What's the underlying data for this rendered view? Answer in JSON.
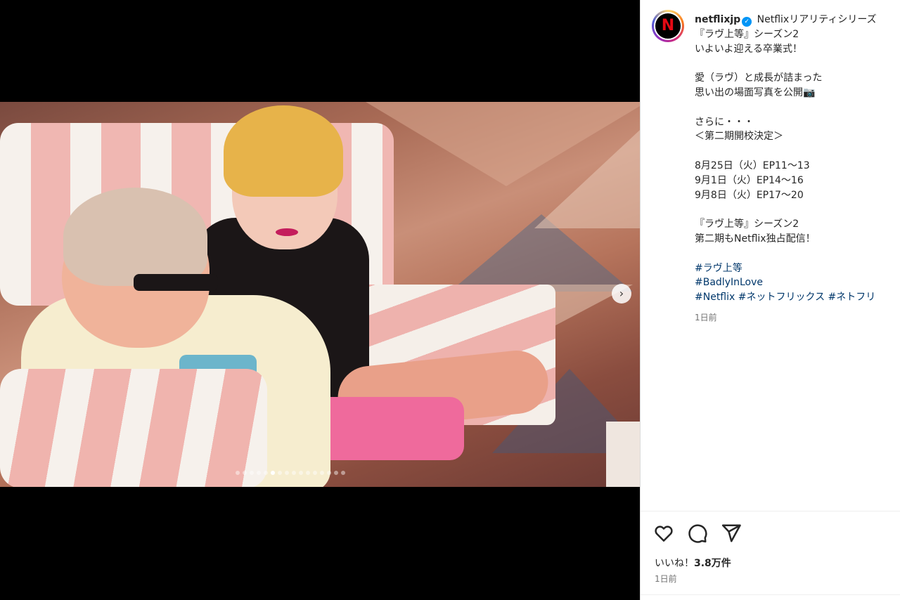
{
  "post": {
    "username": "netflixjp",
    "avatar_letter": "N",
    "verified_glyph": "✓",
    "caption_first": "Netflixリアリティシリーズ",
    "caption_lines": [
      "『ラヴ上等』シーズン2",
      "いよいよ迎える卒業式！",
      "",
      "愛（ラヴ）と成長が詰まった",
      "思い出の場面写真を公開📷",
      "",
      "さらに・・・",
      "＜第二期開校決定＞",
      "",
      "8月25日（火）EP11〜13",
      "9月1日（火）EP14〜16",
      "9月8日（火）EP17〜20",
      "",
      "『ラヴ上等』シーズン2",
      "第二期もNetflix独占配信！",
      ""
    ],
    "hashtags": [
      "#ラヴ上等",
      "#BadlyInLove",
      "#Netflix",
      "#ネットフリックス",
      "#ネトフリ"
    ],
    "caption_time": "1日前",
    "likes_prefix": "いいね！",
    "likes_count": "3.8万件",
    "post_time": "1日前"
  },
  "media": {
    "next_arrow": "›",
    "carousel_total": 16,
    "carousel_active_index": 5
  },
  "colors": {
    "link": "#00376b",
    "verified": "#0095f6",
    "brand": "#e50914"
  },
  "icons": [
    "heart-icon",
    "comment-icon",
    "share-icon",
    "chevron-right-icon",
    "verified-icon"
  ]
}
